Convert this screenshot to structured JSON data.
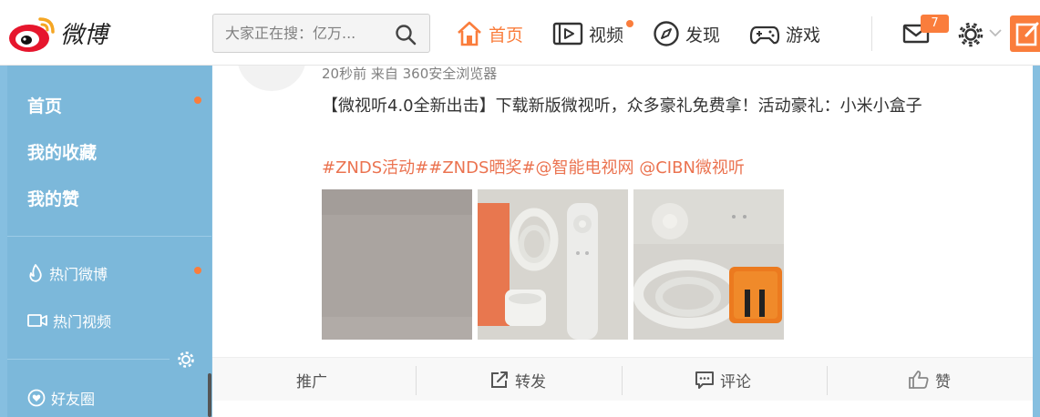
{
  "header": {
    "logo_text": "微博",
    "search": {
      "placeholder": "大家正在搜：亿万..."
    },
    "nav": [
      {
        "label": "首页",
        "icon": "home-icon",
        "active": true
      },
      {
        "label": "视频",
        "icon": "video-icon",
        "has_dot": true
      },
      {
        "label": "发现",
        "icon": "compass-icon"
      },
      {
        "label": "游戏",
        "icon": "gamepad-icon"
      }
    ],
    "message_badge": "7",
    "accent_color": "#fa7d3c"
  },
  "sidebar": {
    "main_items": [
      {
        "label": "首页",
        "has_dot": true
      },
      {
        "label": "我的收藏"
      },
      {
        "label": "我的赞"
      }
    ],
    "sub_items": [
      {
        "label": "热门微博",
        "icon": "fire-icon",
        "has_dot": true
      },
      {
        "label": "热门视频",
        "icon": "video-icon"
      },
      {
        "label": "好友圈",
        "icon": "heart-icon"
      }
    ]
  },
  "post": {
    "meta": "20秒前 来自 360安全浏览器",
    "text": "【微视听4.0全新出击】下载新版微视听，众多豪礼免费拿！活动豪礼：小米小盒子",
    "tags": "#ZNDS活动##ZNDS晒奖#@智能电视网 @CIBN微视听",
    "actions": [
      {
        "label": "推广"
      },
      {
        "label": "转发",
        "icon": "share-icon"
      },
      {
        "label": "评论",
        "icon": "comment-icon"
      },
      {
        "label": "赞",
        "icon": "thumbs-up-icon"
      }
    ]
  }
}
